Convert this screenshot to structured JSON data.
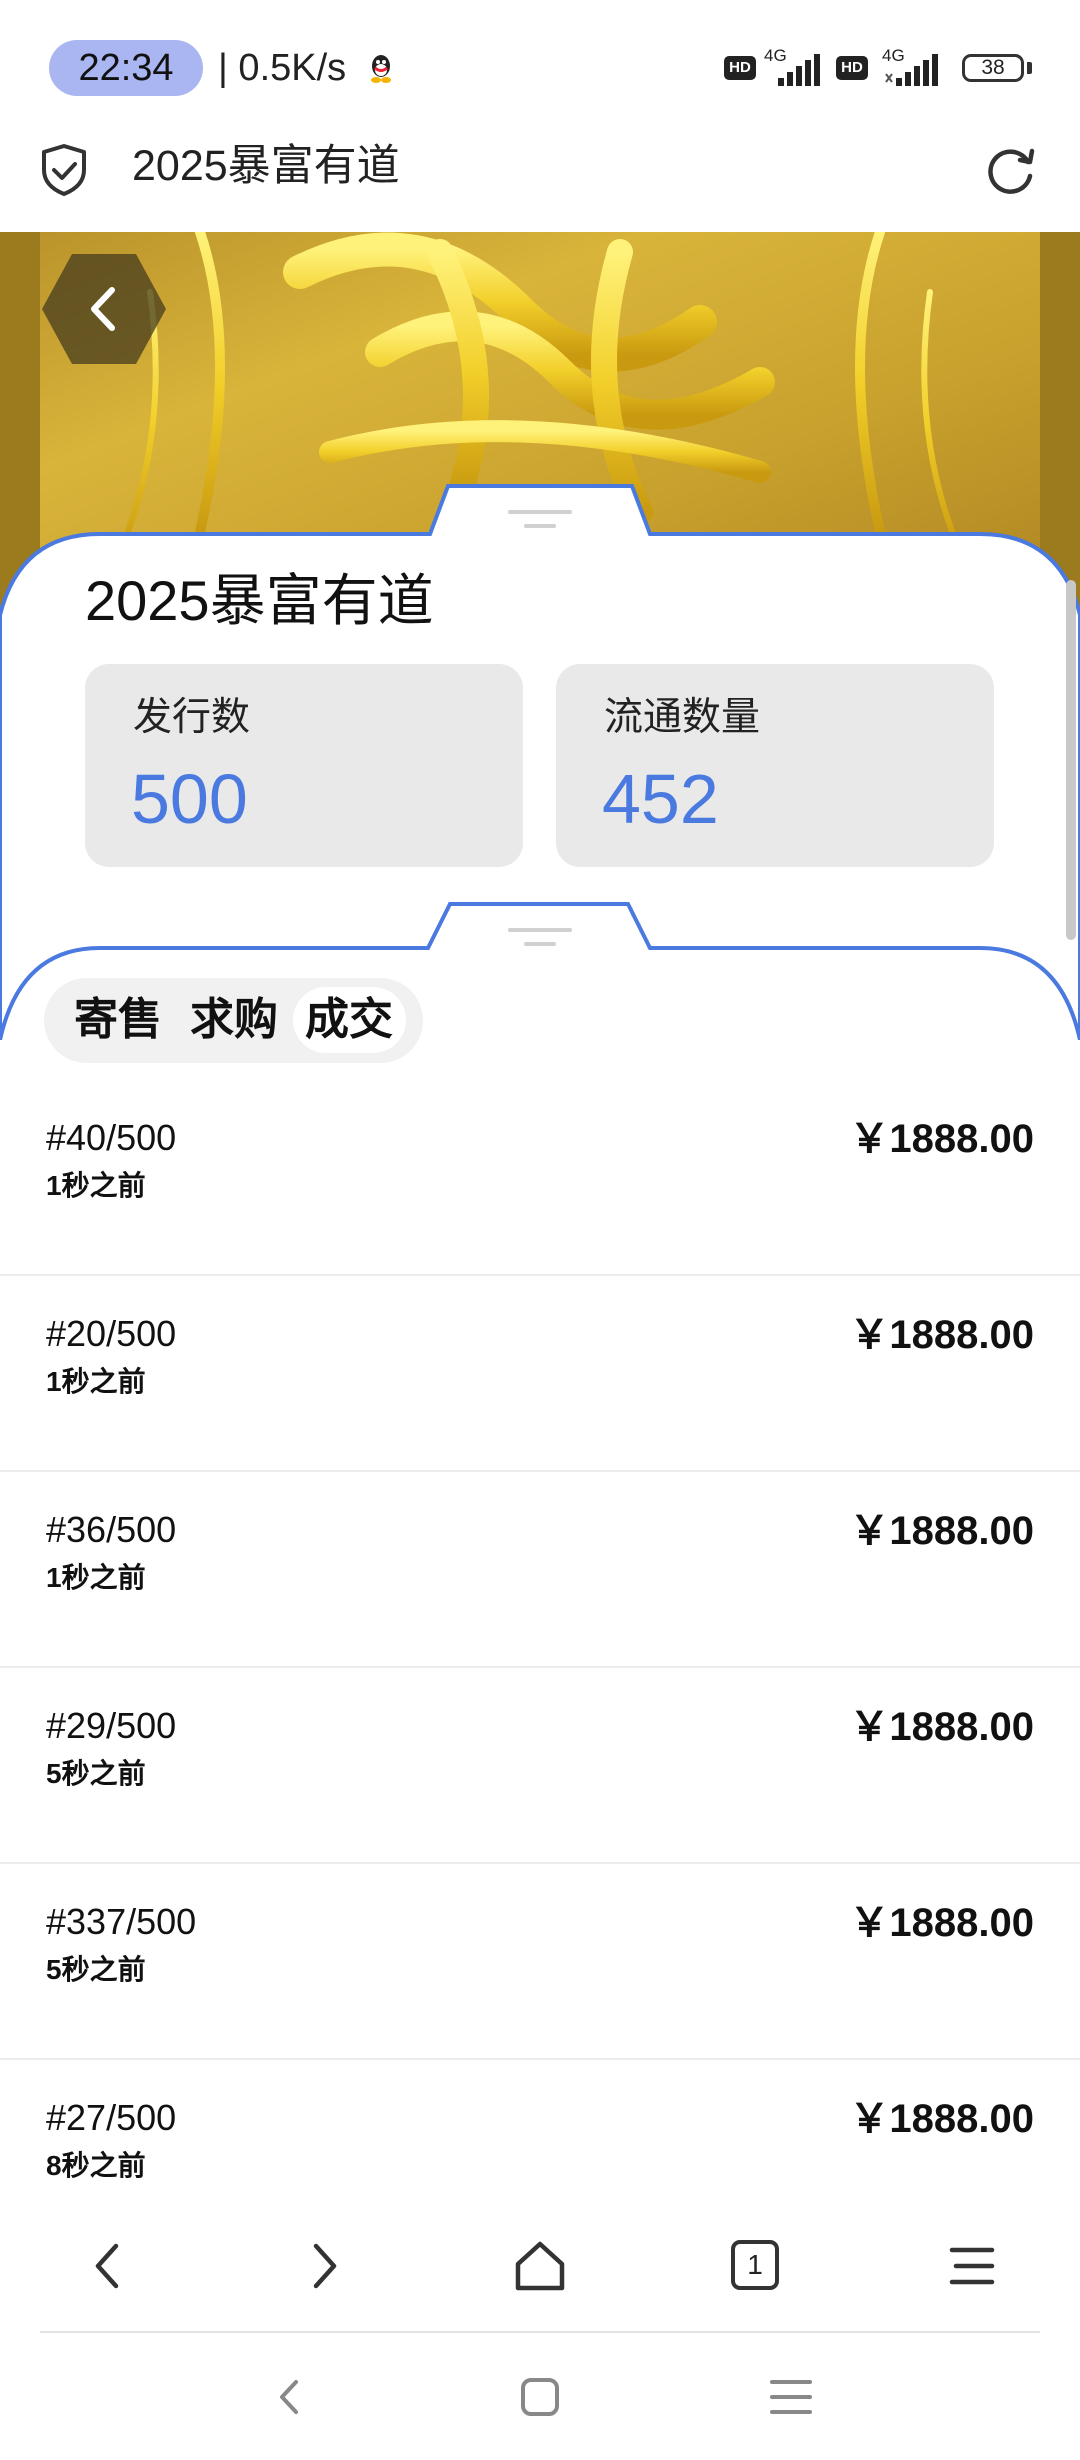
{
  "status_bar": {
    "time": "22:34",
    "net_speed": "| 0.5K/s",
    "sim1_hd": "HD",
    "sim1_network": "4G",
    "sim2_hd": "HD",
    "sim2_network": "4G",
    "battery": "38"
  },
  "browser": {
    "page_title": "2025暴富有道",
    "tab_count": "1"
  },
  "collection": {
    "title": "2025暴富有道",
    "stats": [
      {
        "label": "发行数",
        "value": "500"
      },
      {
        "label": "流通数量",
        "value": "452"
      }
    ]
  },
  "tabs": [
    {
      "label": "寄售",
      "active": false
    },
    {
      "label": "求购",
      "active": false
    },
    {
      "label": "成交",
      "active": true
    }
  ],
  "transactions": [
    {
      "serial": "#40/500",
      "time": "1秒之前",
      "price": "￥1888.00"
    },
    {
      "serial": "#20/500",
      "time": "1秒之前",
      "price": "￥1888.00"
    },
    {
      "serial": "#36/500",
      "time": "1秒之前",
      "price": "￥1888.00"
    },
    {
      "serial": "#29/500",
      "time": "5秒之前",
      "price": "￥1888.00"
    },
    {
      "serial": "#337/500",
      "time": "5秒之前",
      "price": "￥1888.00"
    },
    {
      "serial": "#27/500",
      "time": "8秒之前",
      "price": "￥1888.00"
    }
  ],
  "colors": {
    "accent_blue": "#4a7ae0",
    "time_pill": "#aab6f2",
    "stat_box_bg": "#e9e9e9",
    "hero_gold": "#d9b43a"
  }
}
